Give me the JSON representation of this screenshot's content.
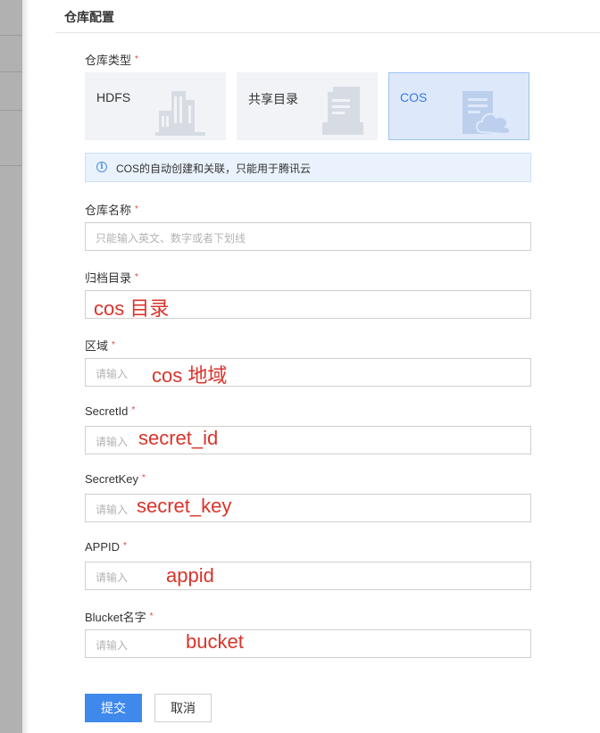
{
  "panel": {
    "title": "仓库配置"
  },
  "form": {
    "required_mark": "*",
    "repo_type": {
      "label": "仓库类型",
      "options": [
        {
          "label": "HDFS",
          "icon": "building-icon",
          "selected": false
        },
        {
          "label": "共享目录",
          "icon": "shared-folder-icon",
          "selected": false
        },
        {
          "label": "COS",
          "icon": "cloud-document-icon",
          "selected": true
        }
      ]
    },
    "notice": {
      "icon": "info-icon",
      "glyph": "i",
      "text": "COS的自动创建和关联，只能用于腾讯云"
    },
    "fields": {
      "repo_name": {
        "label": "仓库名称",
        "placeholder": "只能输入英文、数字或者下划线",
        "value": ""
      },
      "archive_dir": {
        "label": "归档目录",
        "placeholder": "",
        "annotation": "cos 目录"
      },
      "region": {
        "label": "区域",
        "placeholder": "请输入",
        "annotation": "cos 地域"
      },
      "secret_id": {
        "label": "SecretId",
        "placeholder": "请输入",
        "annotation": "secret_id"
      },
      "secret_key": {
        "label": "SecretKey",
        "placeholder": "请输入",
        "annotation": "secret_key"
      },
      "appid": {
        "label": "APPID",
        "placeholder": "请输入",
        "annotation": "appid"
      },
      "bucket": {
        "label": "Blucket名字",
        "placeholder": "请输入",
        "annotation": "bucket"
      }
    }
  },
  "actions": {
    "submit_label": "提交",
    "cancel_label": "取消"
  },
  "colors": {
    "primary": "#3f89ec",
    "required": "#e54545",
    "annotation": "#d9342b",
    "selected_card_bg": "#dde9fb"
  }
}
